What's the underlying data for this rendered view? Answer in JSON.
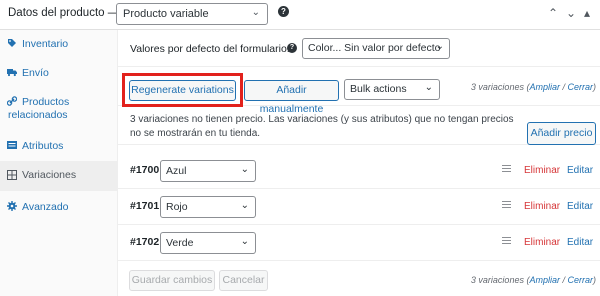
{
  "header": {
    "title": "Datos del producto —",
    "product_type": "Producto variable"
  },
  "sidebar": {
    "tabs": [
      {
        "label": "Inventario",
        "icon": "tag-icon"
      },
      {
        "label": "Envío",
        "icon": "truck-icon"
      },
      {
        "label_line1": "Productos",
        "label_line2": "relacionados",
        "icon": "link-icon"
      },
      {
        "label": "Atributos",
        "icon": "list-icon"
      },
      {
        "label": "Variaciones",
        "icon": "grid-icon"
      },
      {
        "label": "Avanzado",
        "icon": "gear-icon"
      }
    ]
  },
  "defaults": {
    "label": "Valores por defecto del formulario:",
    "color_select": "Color... Sin valor por defecto"
  },
  "actions": {
    "regenerate": "Regenerate variations",
    "add_manual": "Añadir manualmente",
    "bulk": "Bulk actions",
    "count_text": "3 variaciones (",
    "expand": "Ampliar",
    "sep": " / ",
    "close": "Cerrar",
    "close_paren": ")"
  },
  "notice": {
    "text": "3 variaciones no tienen precio. Las variaciones (y sus atributos) que no tengan precios no se mostrarán en tu tienda.",
    "button": "Añadir precio"
  },
  "variations": [
    {
      "id": "#1700",
      "value": "Azul",
      "delete": "Eliminar",
      "edit": "Editar"
    },
    {
      "id": "#1701",
      "value": "Rojo",
      "delete": "Eliminar",
      "edit": "Editar"
    },
    {
      "id": "#1702",
      "value": "Verde",
      "delete": "Eliminar",
      "edit": "Editar"
    }
  ],
  "footer": {
    "save": "Guardar cambios",
    "cancel": "Cancelar"
  },
  "colors": {
    "accent": "#2271b1",
    "delete": "#d63638",
    "highlight_box": "#e2211c"
  }
}
